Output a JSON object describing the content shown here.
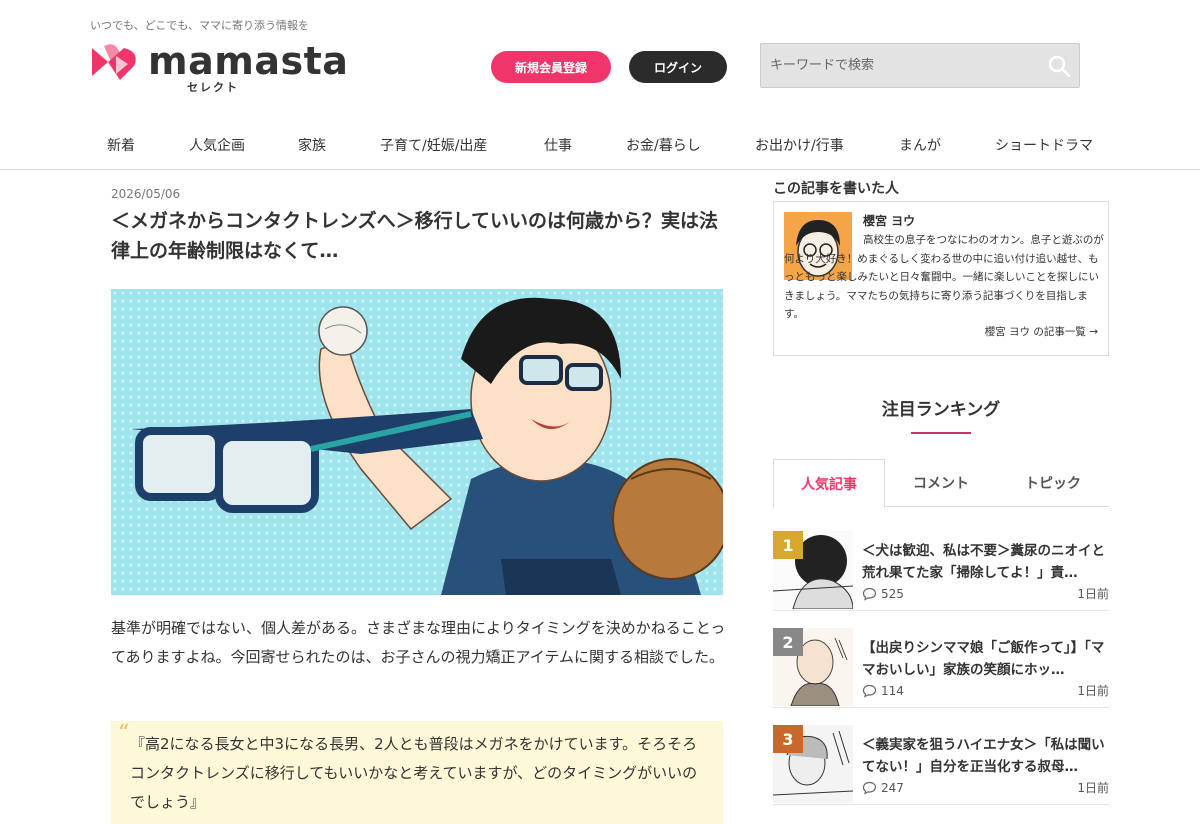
{
  "header": {
    "tagline": "いつでも、どこでも、ママに寄り添う情報を",
    "logo_text": "mamasta",
    "logo_sub": "セレクト",
    "register_label": "新規会員登録",
    "login_label": "ログイン",
    "search_placeholder": "キーワードで検索"
  },
  "colors": {
    "brand_pink": "#f0356a",
    "dark": "#2b2b2b"
  },
  "nav": [
    "新着",
    "人気企画",
    "家族",
    "子育て/妊娠/出産",
    "仕事",
    "お金/暮らし",
    "お出かけ/行事",
    "まんが",
    "ショートドラマ"
  ],
  "article": {
    "date": "2026/05/06",
    "title": "＜メガネからコンタクトレンズへ＞移行していいのは何歳から？実は法律上の年齢制限はなくて…",
    "body": "基準が明確ではない、個人差がある。さまざまな理由によりタイミングを決めかねることってありますよね。今回寄せられたのは、お子さんの視力矯正アイテムに関する相談でした。",
    "quote": "『高2になる長女と中3になる長男、2人とも普段はメガネをかけています。そろそろコンタクトレンズに移行してもいいかなと考えていますが、どのタイミングがいいのでしょう』"
  },
  "author": {
    "heading": "この記事を書いた人",
    "name": "櫻宮 ヨウ",
    "bio": "高校生の息子をつなにわのオカン。息子と遊ぶのが何より大好き！めまぐるしく変わる世の中に追い付け追い越せ、もっともっと楽しみたいと日々奮闘中。一緒に楽しいことを探しにいきましょう。ママたちの気持ちに寄り添う記事づくりを目指します。",
    "link": "櫻宮 ヨウ の記事一覧 →"
  },
  "ranking": {
    "title": "注目ランキング",
    "tabs": [
      "人気記事",
      "コメント",
      "トピック"
    ],
    "items": [
      {
        "rank": "1",
        "title": "＜犬は歓迎、私は不要＞糞尿のニオイと荒れ果てた家「掃除してよ！」責…",
        "comments": "525",
        "ago": "1日前",
        "badge": "#d9a62e"
      },
      {
        "rank": "2",
        "title": "【出戻りシンママ娘「ご飯作って」】「ママおいしい」家族の笑顔にホッ…",
        "comments": "114",
        "ago": "1日前",
        "badge": "#888888"
      },
      {
        "rank": "3",
        "title": "＜義実家を狙うハイエナ女＞「私は聞いてない！」自分を正当化する叔母…",
        "comments": "247",
        "ago": "1日前",
        "badge": "#c8692b"
      }
    ]
  }
}
